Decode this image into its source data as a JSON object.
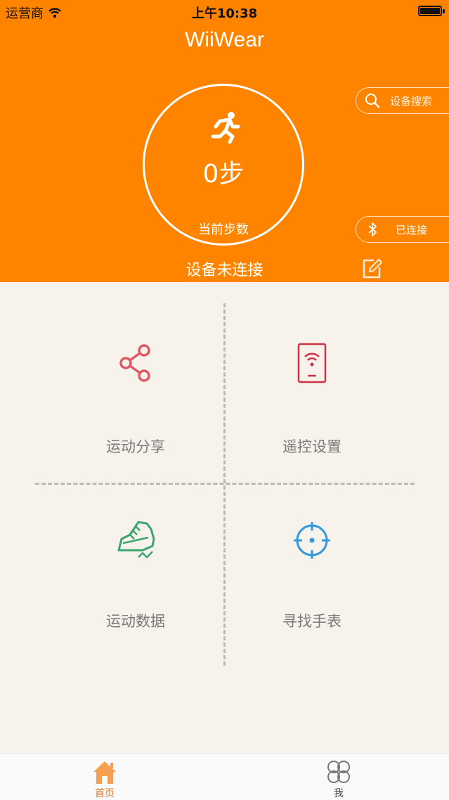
{
  "status_bar": {
    "carrier": "运营商",
    "time": "上午10:38"
  },
  "header": {
    "title": "WiiWear",
    "steps": "0步",
    "steps_label": "当前步数",
    "search_label": "设备搜索",
    "bluetooth_label": "已连接",
    "device_status": "设备未连接"
  },
  "grid": {
    "share_label": "运动分享",
    "remote_label": "遥控设置",
    "data_label": "运动数据",
    "find_label": "寻找手表"
  },
  "tabbar": {
    "home_label": "首页",
    "me_label": "我"
  },
  "colors": {
    "header": "#fe8400",
    "share_icon": "#e05a64",
    "remote_icon": "#cc3344",
    "data_icon": "#3aa56e",
    "find_icon": "#3399dd",
    "tab_active": "#f5a050"
  }
}
